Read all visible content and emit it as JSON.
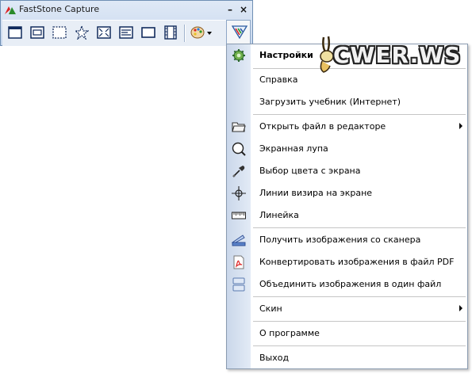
{
  "window": {
    "title": "FastStone Capture"
  },
  "toolbar": {
    "tools": [
      {
        "icon": "capture-active-window-icon"
      },
      {
        "icon": "capture-window-object-icon"
      },
      {
        "icon": "capture-rectangular-region-icon"
      },
      {
        "icon": "capture-freehand-region-icon"
      },
      {
        "icon": "capture-full-screen-icon"
      },
      {
        "icon": "capture-scrolling-window-icon"
      },
      {
        "icon": "capture-fixed-region-icon"
      },
      {
        "icon": "screen-recorder-icon"
      },
      {
        "icon": "output-palette-icon"
      },
      {
        "icon": "settings-menu-icon"
      }
    ]
  },
  "menu": {
    "items": [
      {
        "label": "Настройки",
        "icon": "gear-icon"
      },
      {
        "label": "Справка",
        "icon": ""
      },
      {
        "label": "Загрузить учебник (Интернет)",
        "icon": ""
      },
      {
        "label": "Открыть файл в редакторе",
        "icon": "open-folder-icon"
      },
      {
        "label": "Экранная лупа",
        "icon": "magnifier-icon"
      },
      {
        "label": "Выбор цвета с экрана",
        "icon": "eyedropper-icon"
      },
      {
        "label": "Линии визира на экране",
        "icon": "crosshair-icon"
      },
      {
        "label": "Линейка",
        "icon": "ruler-icon"
      },
      {
        "label": "Получить изображения со сканера",
        "icon": "scanner-icon"
      },
      {
        "label": "Конвертировать изображения в файл PDF",
        "icon": "pdf-icon"
      },
      {
        "label": "Объединить изображения в один файл",
        "icon": "join-images-icon"
      },
      {
        "label": "Скин",
        "icon": ""
      },
      {
        "label": "О программе",
        "icon": ""
      },
      {
        "label": "Выход",
        "icon": ""
      }
    ]
  },
  "watermark": {
    "text": "CWER.WS"
  },
  "colors": {
    "menu_strip": "#cad7ea",
    "titlebar": "#dfe9f6",
    "border": "#6f8fb4"
  }
}
